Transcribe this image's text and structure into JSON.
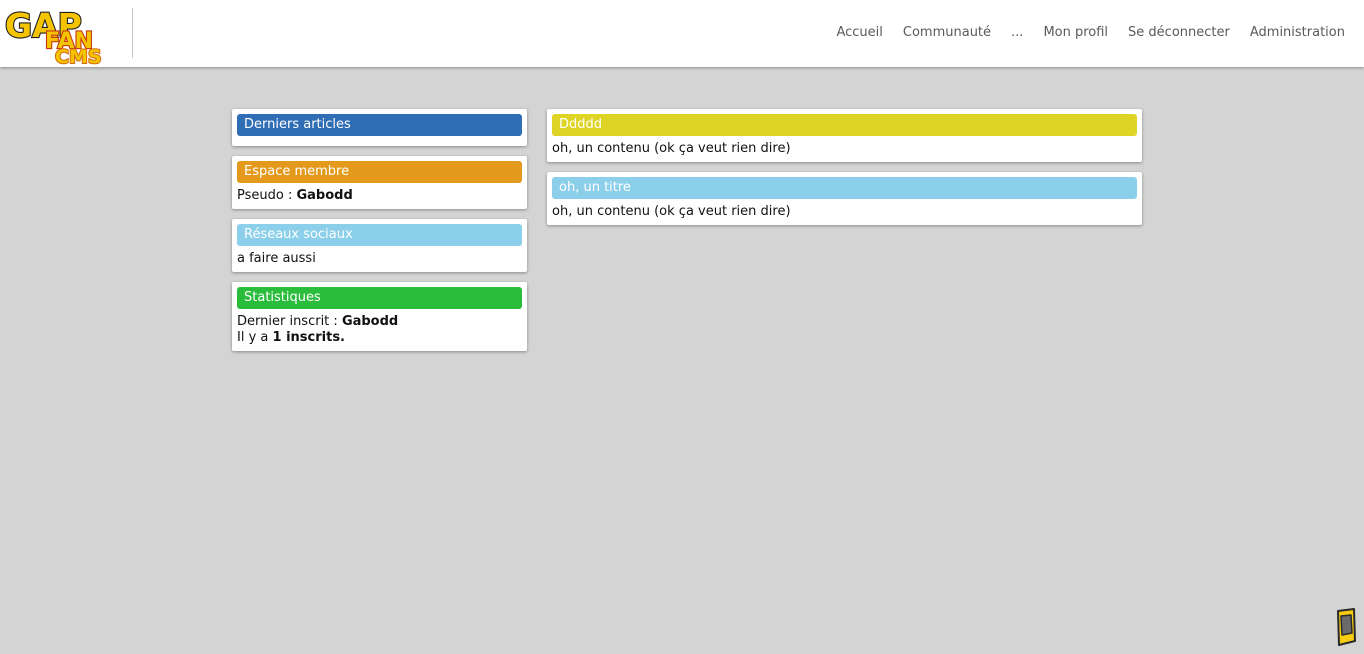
{
  "logo": {
    "line1": "GAP",
    "line2": "FAN",
    "line3": "CMS"
  },
  "nav": {
    "items": [
      "Accueil",
      "Communauté",
      "...",
      "Mon profil",
      "Se déconnecter",
      "Administration"
    ]
  },
  "sidebar": {
    "last_articles": {
      "title": "Derniers articles",
      "color": "#2f6db5"
    },
    "member_space": {
      "title": "Espace membre",
      "color": "#e39a1c",
      "pseudo_label": "Pseudo :",
      "pseudo_value": "Gabodd"
    },
    "social": {
      "title": "Réseaux sociaux",
      "color": "#8ccfea",
      "text": "a faire aussi"
    },
    "stats": {
      "title": "Statistiques",
      "color": "#2abd3c",
      "last_member_label": "Dernier inscrit :",
      "last_member_value": "Gabodd",
      "count_prefix": "Il y a",
      "count_value": "1 inscrits."
    }
  },
  "main": {
    "articles": [
      {
        "title": "Ddddd",
        "color": "#ddd425",
        "content": "oh, un contenu (ok ça veut rien dire)"
      },
      {
        "title": "oh, un titre",
        "color": "#8ccfea",
        "content": "oh, un contenu (ok ça veut rien dire)"
      }
    ]
  },
  "corner_icon": "phone-icon"
}
